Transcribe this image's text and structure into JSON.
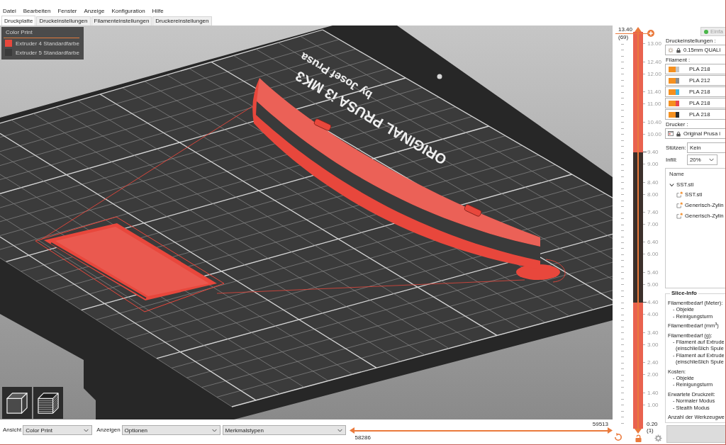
{
  "menu": [
    "Datei",
    "Bearbeiten",
    "Fenster",
    "Anzeige",
    "Konfiguration",
    "Hilfe"
  ],
  "tabs": [
    {
      "label": "Druckplatte",
      "selected": true
    },
    {
      "label": "Druckeinstellungen",
      "selected": false
    },
    {
      "label": "Filamenteinstellungen",
      "selected": false
    },
    {
      "label": "Druckereinstellungen",
      "selected": false
    }
  ],
  "viewport": {
    "legend": {
      "title": "Color Print",
      "items": [
        {
          "label": "Extruder 4 Standardfarbe",
          "color": "#e8473c"
        },
        {
          "label": "Extruder 5 Standardfarbe",
          "color": "#3a3a3a"
        }
      ]
    },
    "bed_labels": [
      "ORIGINAL PRUSA i3 MK3",
      "by Josef Prusa"
    ]
  },
  "bottom_bar": {
    "view": {
      "label": "Ansicht",
      "value": "Color Print"
    },
    "show": {
      "label": "Anzeigen",
      "value": "Optionen"
    },
    "features": {
      "value": "Merkmalstypen"
    },
    "move_slider": {
      "right_value": "59513",
      "left_value": "58286"
    }
  },
  "layer_slider": {
    "top_value": "13.40",
    "top_layer": "(69)",
    "ticks": [
      {
        "label": "13.00",
        "color_change": false
      },
      {
        "label": "12.40",
        "color_change": false
      },
      {
        "label": "12.00",
        "color_change": false
      },
      {
        "label": "11.40",
        "color_change": false
      },
      {
        "label": "11.00",
        "color_change": false
      },
      {
        "label": "10.40",
        "color_change": false
      },
      {
        "label": "10.00",
        "color_change": false
      },
      {
        "label": "9.40",
        "color_change": true
      },
      {
        "label": "9.00",
        "color_change": false
      },
      {
        "label": "8.40",
        "color_change": false
      },
      {
        "label": "8.00",
        "color_change": false
      },
      {
        "label": "7.40",
        "color_change": false
      },
      {
        "label": "7.00",
        "color_change": false
      },
      {
        "label": "6.40",
        "color_change": false
      },
      {
        "label": "6.00",
        "color_change": false
      },
      {
        "label": "5.40",
        "color_change": false
      },
      {
        "label": "5.00",
        "color_change": false
      },
      {
        "label": "4.40",
        "color_change": true
      },
      {
        "label": "4.00",
        "color_change": false
      },
      {
        "label": "3.40",
        "color_change": false
      },
      {
        "label": "3.00",
        "color_change": false
      },
      {
        "label": "2.40",
        "color_change": false
      },
      {
        "label": "2.00",
        "color_change": false
      },
      {
        "label": "1.40",
        "color_change": false
      },
      {
        "label": "1.00",
        "color_change": false
      }
    ],
    "bands": [
      {
        "color": "#e9624f"
      },
      {
        "color": "#3c302b"
      },
      {
        "color": "#e9624f"
      }
    ],
    "bottom_value": "0.20",
    "bottom_layer": "(1)"
  },
  "sidebar": {
    "mode_button": "Einfa",
    "print_settings": {
      "label": "Druckeinstellungen :",
      "value": "0.15mm QUALI"
    },
    "filament": {
      "label": "Filament :",
      "items": [
        {
          "value": "PLA 218",
          "color": "#c8c8c8"
        },
        {
          "value": "PLA 212",
          "color": "#8c8c8c"
        },
        {
          "value": "PLA 218",
          "color": "#45b5e3"
        },
        {
          "value": "PLA 218",
          "color": "#e8474f"
        },
        {
          "value": "PLA 218",
          "color": "#2e2e2e"
        }
      ]
    },
    "printer": {
      "label": "Drucker :",
      "value": "Original Prusa i"
    },
    "supports": {
      "label": "Stützen:",
      "value": "Kein"
    },
    "infill": {
      "label": "Infill:",
      "value": "20%"
    },
    "object_list": {
      "header": "Name",
      "items": [
        {
          "name": "SST.stl",
          "expanded": true,
          "children": [
            {
              "name": "SST.stl"
            },
            {
              "name": "Generisch-Zylin"
            },
            {
              "name": "Generisch-Zylin"
            }
          ]
        }
      ]
    },
    "slice_info": {
      "title": "Slice-Info",
      "groups": [
        {
          "label": "Filamentbedarf (Meter):",
          "items": [
            {
              "text": "- Objekte"
            },
            {
              "text": "- Reinigungsturm"
            }
          ]
        },
        {
          "label": "Filamentbedarf (mm$^{3}$)"
        },
        {
          "label": "Filamentbedarf (g):",
          "items": [
            {
              "text": "- Filament auf Extrude",
              "second_line": "(einschließlich Spule"
            },
            {
              "text": "- Filament auf Extrude",
              "second_line": "(einschließlich Spule"
            }
          ]
        },
        {
          "label": "Kosten:",
          "items": [
            {
              "text": "- Objekte"
            },
            {
              "text": "- Reinigungsturm"
            }
          ]
        },
        {
          "label": "Erwartete Druckzeit:",
          "items": [
            {
              "text": "- Normaler Modus"
            },
            {
              "text": "- Stealth Modus"
            }
          ]
        },
        {
          "label": "Anzahl der Werkzeugwe"
        }
      ]
    }
  }
}
